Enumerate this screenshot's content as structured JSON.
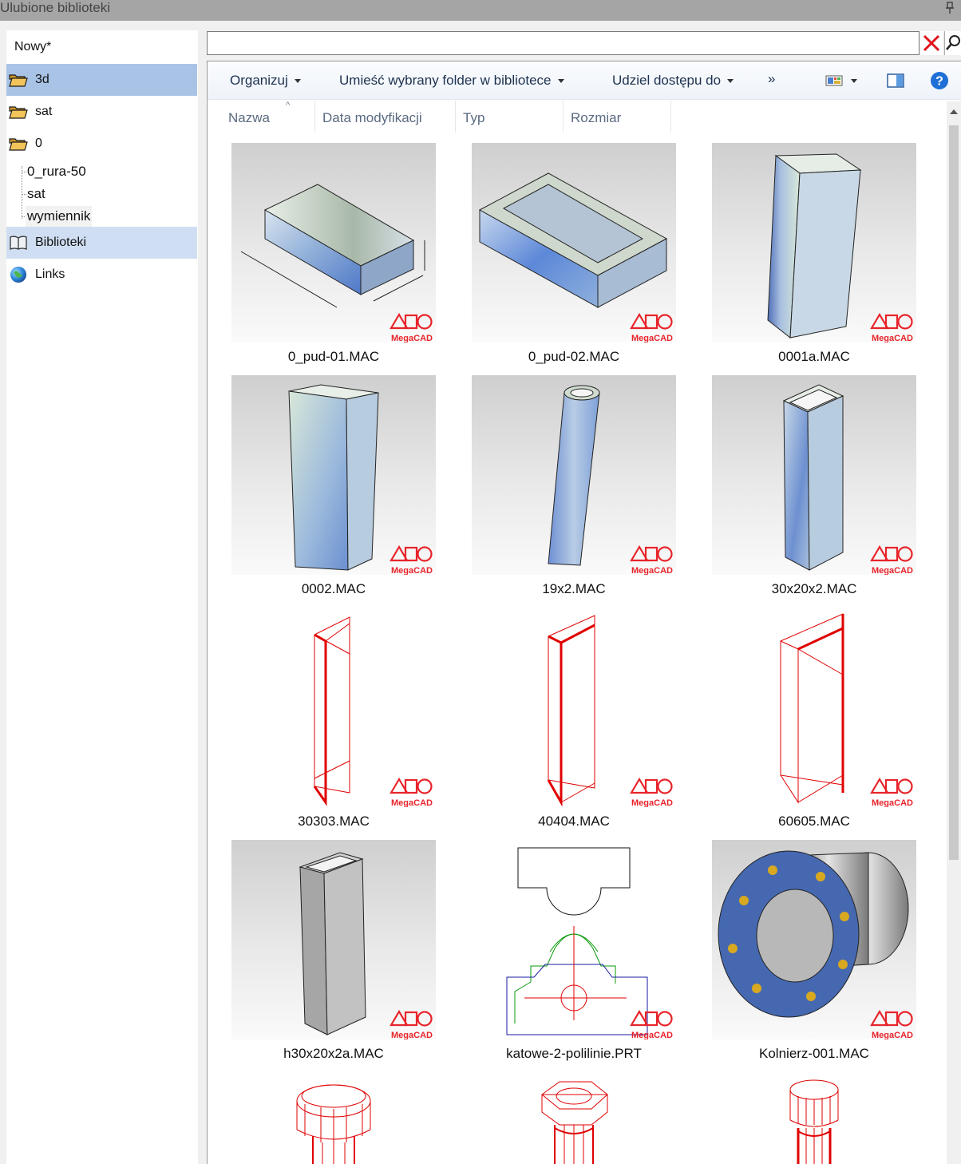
{
  "window": {
    "title": "Ulubione biblioteki"
  },
  "sidebar": {
    "top_item": "Nowy*",
    "items": [
      {
        "label": "3d",
        "icon": "folder-open-icon"
      },
      {
        "label": "sat",
        "icon": "folder-open-icon"
      },
      {
        "label": "0",
        "icon": "folder-open-icon"
      }
    ],
    "subitems": [
      "0_rura-50",
      "sat",
      "wymiennik"
    ],
    "libraries_label": "Biblioteki",
    "links_label": "Links"
  },
  "search": {
    "value": "",
    "placeholder": ""
  },
  "toolbar": {
    "organize": "Organizuj",
    "include_folder": "Umieść wybrany folder w bibliotece",
    "share_with": "Udziel dostępu do",
    "more": "»"
  },
  "columns": [
    "Nazwa",
    "Data modyfikacji",
    "Typ",
    "Rozmiar"
  ],
  "files": [
    "0_pud-01.MAC",
    "0_pud-02.MAC",
    "0001a.MAC",
    "0002.MAC",
    "19x2.MAC",
    "30x20x2.MAC",
    "30303.MAC",
    "40404.MAC",
    "60605.MAC",
    "h30x20x2a.MAC",
    "katowe-2-polilinie.PRT",
    "Kolnierz-001.MAC"
  ],
  "watermark": "MegaCAD",
  "colors": {
    "selected": "#a9c3e6",
    "hover": "#cfdef2",
    "wire_red": "#e00000",
    "watermark_red": "#e8242b"
  }
}
